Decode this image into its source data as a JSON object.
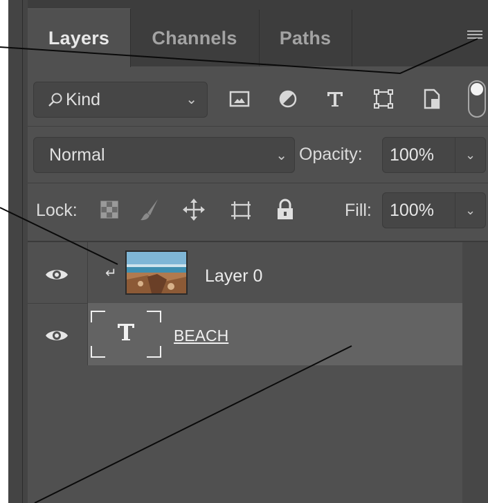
{
  "tabs": [
    {
      "label": "Layers",
      "active": true
    },
    {
      "label": "Channels",
      "active": false
    },
    {
      "label": "Paths",
      "active": false
    }
  ],
  "filter": {
    "kind_label": "Kind",
    "icons": [
      "image-filter-icon",
      "adjustment-filter-icon",
      "type-filter-icon",
      "shape-filter-icon",
      "smart-object-filter-icon",
      "filter-toggle-icon"
    ]
  },
  "blend": {
    "mode": "Normal",
    "opacity_label": "Opacity:",
    "opacity_value": "100%"
  },
  "lock": {
    "label": "Lock:",
    "icons": [
      "lock-transparent-pixels-icon",
      "lock-image-pixels-icon",
      "lock-position-icon",
      "lock-artboard-icon",
      "lock-all-icon"
    ],
    "fill_label": "Fill:",
    "fill_value": "100%"
  },
  "layers": [
    {
      "name": "Layer 0",
      "clipped": true,
      "visible": true
    },
    {
      "name": "BEACH",
      "type": "text",
      "visible": true,
      "selected": true
    }
  ],
  "colors": {
    "panel": "#505050",
    "tab_bar": "#3d3d3d",
    "selected_row": "#636363"
  }
}
